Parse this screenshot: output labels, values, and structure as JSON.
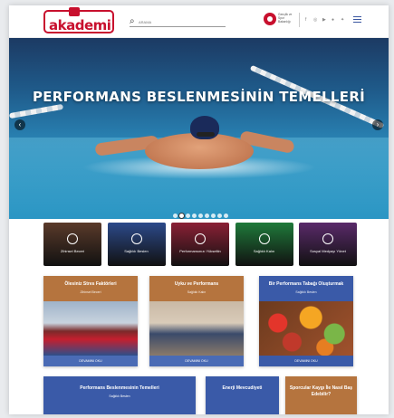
{
  "header": {
    "logo_text": "akademi",
    "search_placeholder": "ARAMA",
    "emblem_text": "Gençlik ve Spor Bakanlığı",
    "social_icons": [
      "facebook-icon",
      "instagram-icon",
      "youtube-icon",
      "flickr-icon",
      "twitter-icon"
    ],
    "social_glyphs": [
      "f",
      "◎",
      "▶",
      "●",
      "✦"
    ]
  },
  "hero": {
    "title": "PERFORMANS BESLENMESİNİN TEMELLERİ",
    "dots_total": 9,
    "active_dot": 1
  },
  "tiles": [
    {
      "label": "Zihinsel Beceri",
      "color": "#5a3a2a"
    },
    {
      "label": "Sağlıklı Beslen",
      "color": "#2c4a8a"
    },
    {
      "label": "Performansınızı Yükseltin",
      "color": "#8a2035"
    },
    {
      "label": "Sağlıklı Kalın",
      "color": "#1f7a3a"
    },
    {
      "label": "Sosyal Medyayı Yönet",
      "color": "#5a2a6a"
    }
  ],
  "cards": [
    {
      "title": "Ölesiniz Stres Faktörleri",
      "subtitle": "Zihinsel Beceri",
      "button": "DEVAMINI OKU",
      "color": "#b5743e",
      "btn_color": "#4a6bb5"
    },
    {
      "title": "Uyku ve Performans",
      "subtitle": "Sağlıklı Kalın",
      "button": "DEVAMINI OKU",
      "color": "#b5743e",
      "btn_color": "#4a6bb5"
    },
    {
      "title": "Bir Performans Tabağı Oluşturmak",
      "subtitle": "Sağlıklı Beslen",
      "button": "DEVAMINI OKU",
      "color": "#3a5aa8",
      "btn_color": "#3a5aa8"
    }
  ],
  "bottom_cards": [
    {
      "title": "Performans Beslenmesinin Temelleri",
      "subtitle": "Sağlıklı Beslen",
      "color": "#3a5aa8"
    },
    {
      "title": "Enerji Mevcudiyeti",
      "subtitle": "",
      "color": "#3a5aa8"
    },
    {
      "title": "Sporcular Kaygı İle Nasıl Baş Edebilir?",
      "subtitle": "",
      "color": "#b5743e"
    }
  ]
}
